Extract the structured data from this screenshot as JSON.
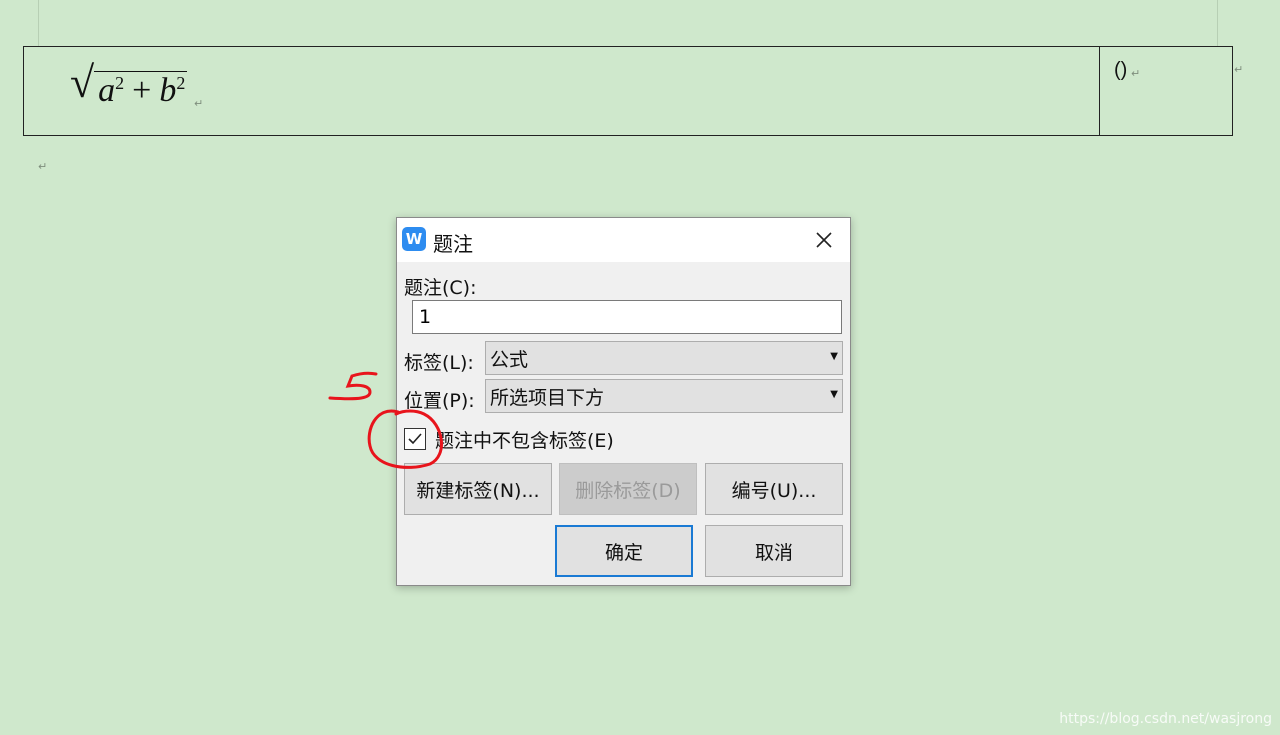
{
  "document": {
    "formula": {
      "base_a": "a",
      "exp_a": "2",
      "op": "+",
      "base_b": "b",
      "exp_b": "2"
    },
    "equation_number": "()",
    "paragraph_mark": "↵"
  },
  "dialog": {
    "title": "题注",
    "app_icon_glyph": "W",
    "caption_label": "题注(C):",
    "caption_value": "1",
    "tag_label": "标签(L):",
    "tag_value": "公式",
    "position_label": "位置(P):",
    "position_value": "所选项目下方",
    "exclude_label_checkbox": {
      "label": "题注中不包含标签(E)",
      "checked": true
    },
    "buttons": {
      "new_label": "新建标签(N)...",
      "delete_label": "删除标签(D)",
      "numbering": "编号(U)...",
      "ok": "确定",
      "cancel": "取消"
    }
  },
  "annotation": {
    "digit": "5",
    "color": "#e8141c"
  },
  "watermark": "https://blog.csdn.net/wasjrong",
  "colors": {
    "page_background": "#cfe8cc",
    "app_icon": "#2d8cf0",
    "default_button_border": "#1a7ad4"
  }
}
